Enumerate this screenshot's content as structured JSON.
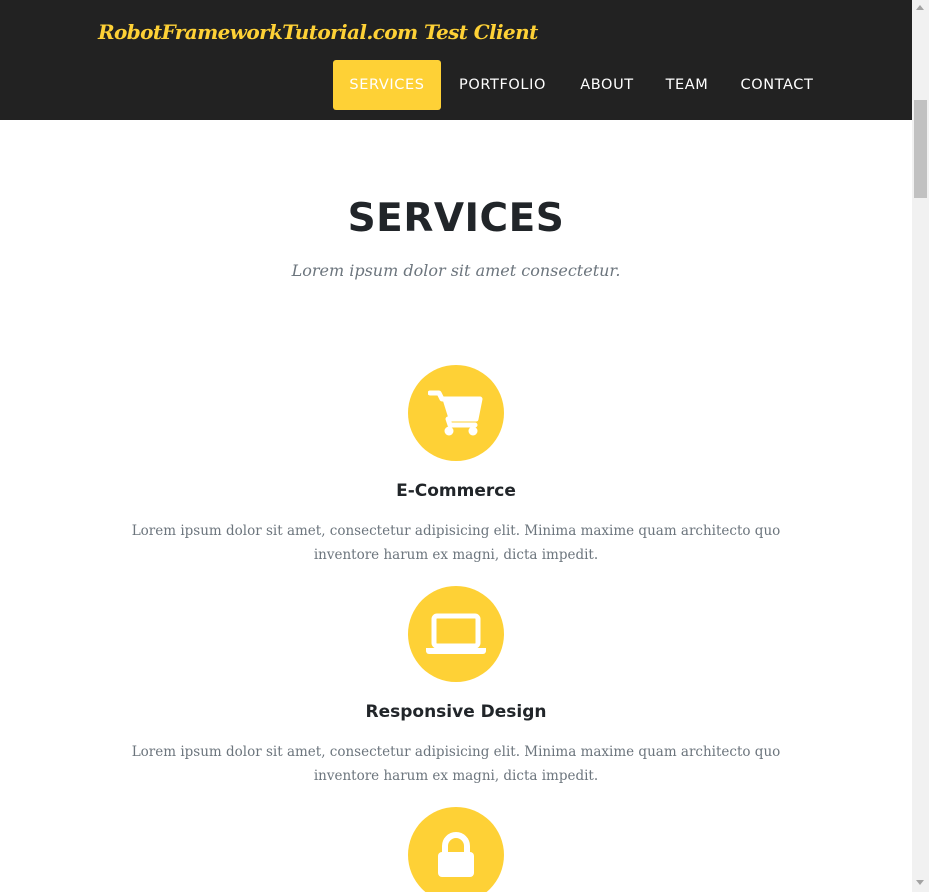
{
  "brand": "RobotFrameworkTutorial.com Test Client",
  "nav": {
    "items": [
      {
        "label": "SERVICES",
        "active": true
      },
      {
        "label": "PORTFOLIO",
        "active": false
      },
      {
        "label": "ABOUT",
        "active": false
      },
      {
        "label": "TEAM",
        "active": false
      },
      {
        "label": "CONTACT",
        "active": false
      }
    ]
  },
  "section": {
    "title": "SERVICES",
    "subtitle": "Lorem ipsum dolor sit amet consectetur."
  },
  "services": [
    {
      "icon": "shopping-cart-icon",
      "heading": "E-Commerce",
      "text": "Lorem ipsum dolor sit amet, consectetur adipisicing elit. Minima maxime quam architecto quo inventore harum ex magni, dicta impedit."
    },
    {
      "icon": "laptop-icon",
      "heading": "Responsive Design",
      "text": "Lorem ipsum dolor sit amet, consectetur adipisicing elit. Minima maxime quam architecto quo inventore harum ex magni, dicta impedit."
    },
    {
      "icon": "lock-icon",
      "heading": "",
      "text": ""
    }
  ],
  "colors": {
    "accent": "#fed136",
    "navbar_bg": "#222222",
    "heading": "#212529",
    "muted": "#6c757d"
  }
}
